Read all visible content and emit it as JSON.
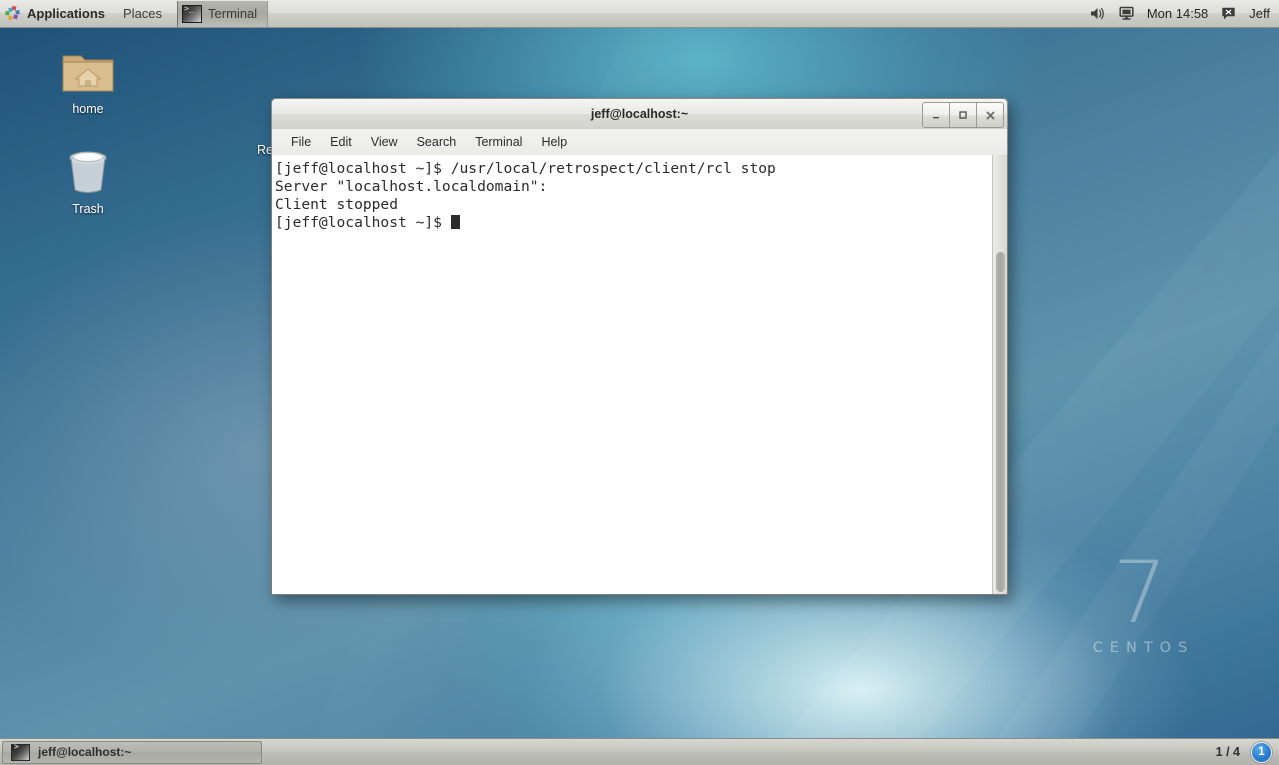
{
  "top_panel": {
    "applications_label": "Applications",
    "places_label": "Places",
    "applications_icon": "pinwheel-icon",
    "window_list": [
      {
        "label": "Terminal",
        "icon": "terminal-icon"
      }
    ],
    "tray": {
      "volume_icon": "speaker-volume-icon",
      "display_icon": "monitor-display-icon",
      "clock": "Mon 14:58",
      "user_icon": "user-account-icon",
      "user_name": "Jeff"
    }
  },
  "desktop": {
    "icons": [
      {
        "label": "home",
        "icon": "home-folder-icon"
      },
      {
        "label": "Trash",
        "icon": "trash-can-icon"
      },
      {
        "label": "Re",
        "icon": "occluded-desktop-icon"
      }
    ],
    "watermark": {
      "version": "7",
      "name": "CENTOS"
    }
  },
  "terminal_window": {
    "title": "jeff@localhost:~",
    "controls": {
      "minimize": "_",
      "maximize": "□",
      "close": "✕"
    },
    "menu": [
      "File",
      "Edit",
      "View",
      "Search",
      "Terminal",
      "Help"
    ],
    "content_lines": [
      "[jeff@localhost ~]$ /usr/local/retrospect/client/rcl stop",
      "Server \"localhost.localdomain\":",
      "Client stopped"
    ],
    "prompt": "[jeff@localhost ~]$ ",
    "scrollbar": "vertical-scrollbar"
  },
  "bottom_panel": {
    "tasks": [
      {
        "label": "jeff@localhost:~",
        "icon": "terminal-icon"
      }
    ],
    "workspace_indicator": "1 / 4",
    "notification_count": "1"
  },
  "colors": {
    "panel_bg": "#d6d6d2",
    "desktop_blue": "#4d82a0",
    "terminal_bg": "#ffffff",
    "terminal_fg": "#2b2b2b",
    "badge_blue": "#2a7fd0"
  }
}
